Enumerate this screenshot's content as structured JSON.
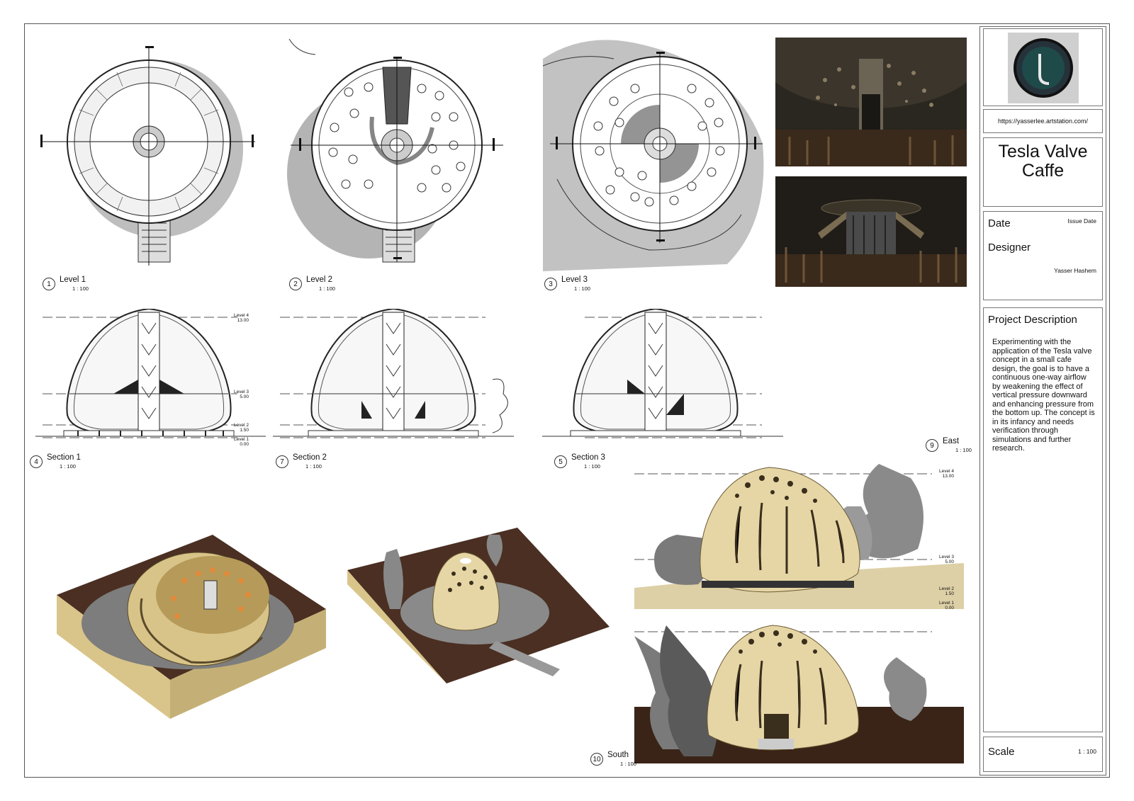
{
  "sheet": {
    "views": [
      {
        "num": "1",
        "name": "Level 1",
        "scale": "1 : 100"
      },
      {
        "num": "2",
        "name": "Level 2",
        "scale": "1 : 100"
      },
      {
        "num": "3",
        "name": "Level 3",
        "scale": "1 : 100"
      },
      {
        "num": "4",
        "name": "Section 1",
        "scale": "1 : 100"
      },
      {
        "num": "7",
        "name": "Section 2",
        "scale": "1 : 100"
      },
      {
        "num": "5",
        "name": "Section 3",
        "scale": "1 : 100"
      },
      {
        "num": "9",
        "name": "East",
        "scale": "1 : 100"
      },
      {
        "num": "10",
        "name": "South",
        "scale": "1 : 100"
      }
    ],
    "levels": [
      {
        "name": "Level 4",
        "value": "13.00"
      },
      {
        "name": "Level 3",
        "value": "5.00"
      },
      {
        "name": "Level 2",
        "value": "1.50"
      },
      {
        "name": "Level 1",
        "value": "0.00"
      }
    ]
  },
  "titleblock": {
    "url": "https://yasserlee.artstation.com/",
    "project_title": "Tesla Valve Caffe",
    "date_label": "Date",
    "date_value": "Issue Date",
    "designer_label": "Designer",
    "designer_value": "Yasser Hashem",
    "description_heading": "Project Description",
    "description": "Experimenting with the application of the Tesla valve concept in a small cafe design, the goal is to have a continuous one-way airflow by weakening the effect of vertical pressure downward and enhancing pressure from the bottom up. The concept is in its infancy and needs verification through simulations and further research.",
    "scale_label": "Scale",
    "scale_value": "1 : 100"
  },
  "colors": {
    "dome": "#e6d6a6",
    "ground": "#4a2f22",
    "sand": "#d9c58a",
    "render_bg": "#2a2620"
  }
}
